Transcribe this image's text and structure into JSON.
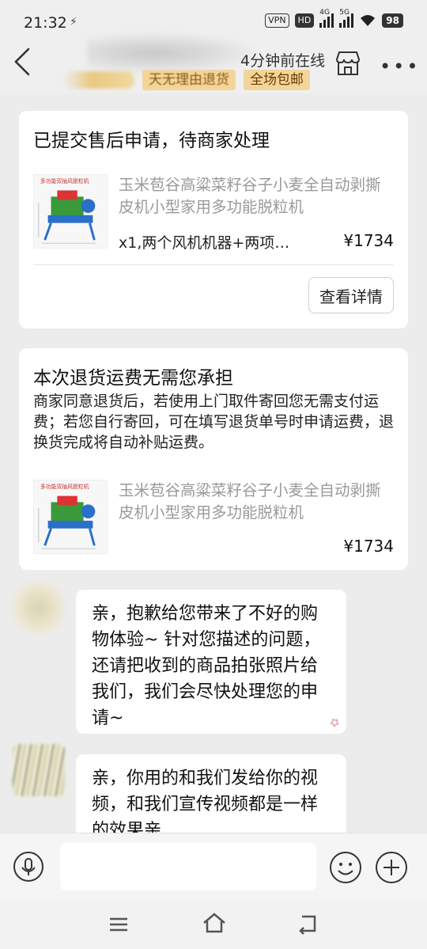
{
  "status_bar": {
    "time": "21:32",
    "vpn": "VPN",
    "hd": "HD",
    "net1": "4G",
    "net2": "5G",
    "battery": "98"
  },
  "header": {
    "online_status": "4分钟前在线",
    "tags": [
      "天无理由退货",
      "全场包邮"
    ]
  },
  "after_sale_card": {
    "title": "已提交售后申请，待商家处理",
    "product_name": "玉米苞谷高粱菜籽谷子小麦全自动剥撕皮机小型家用多功能脱粒机",
    "spec": "x1,两个风机机器+两项…",
    "price": "¥1734",
    "detail_button": "查看详情"
  },
  "shipping_card": {
    "title": "本次退货运费无需您承担",
    "description": "商家同意退货后，若使用上门取件寄回您无需支付运费；若您自行寄回，可在填写退货单号时申请运费，退换货完成将自动补贴运费。",
    "product_name": "玉米苞谷高粱菜籽谷子小麦全自动剥撕皮机小型家用多功能脱粒机",
    "price": "¥1734"
  },
  "messages": [
    {
      "text": "亲，抱歉给您带来了不好的购物体验~ 针对您描述的问题，还请把收到的商品拍张照片给我们，我们会尽快处理您的申请~"
    },
    {
      "text": "亲，你用的和我们发给你的视频，和我们宣传视频都是一样的效果亲"
    }
  ],
  "thumb_caption": "多功能双抽风脱粒机",
  "icons": {
    "back": "back-arrow-icon",
    "shop": "shop-icon",
    "more": "more-icon",
    "voice": "voice-icon",
    "emoji": "emoji-icon",
    "plus": "plus-icon"
  }
}
